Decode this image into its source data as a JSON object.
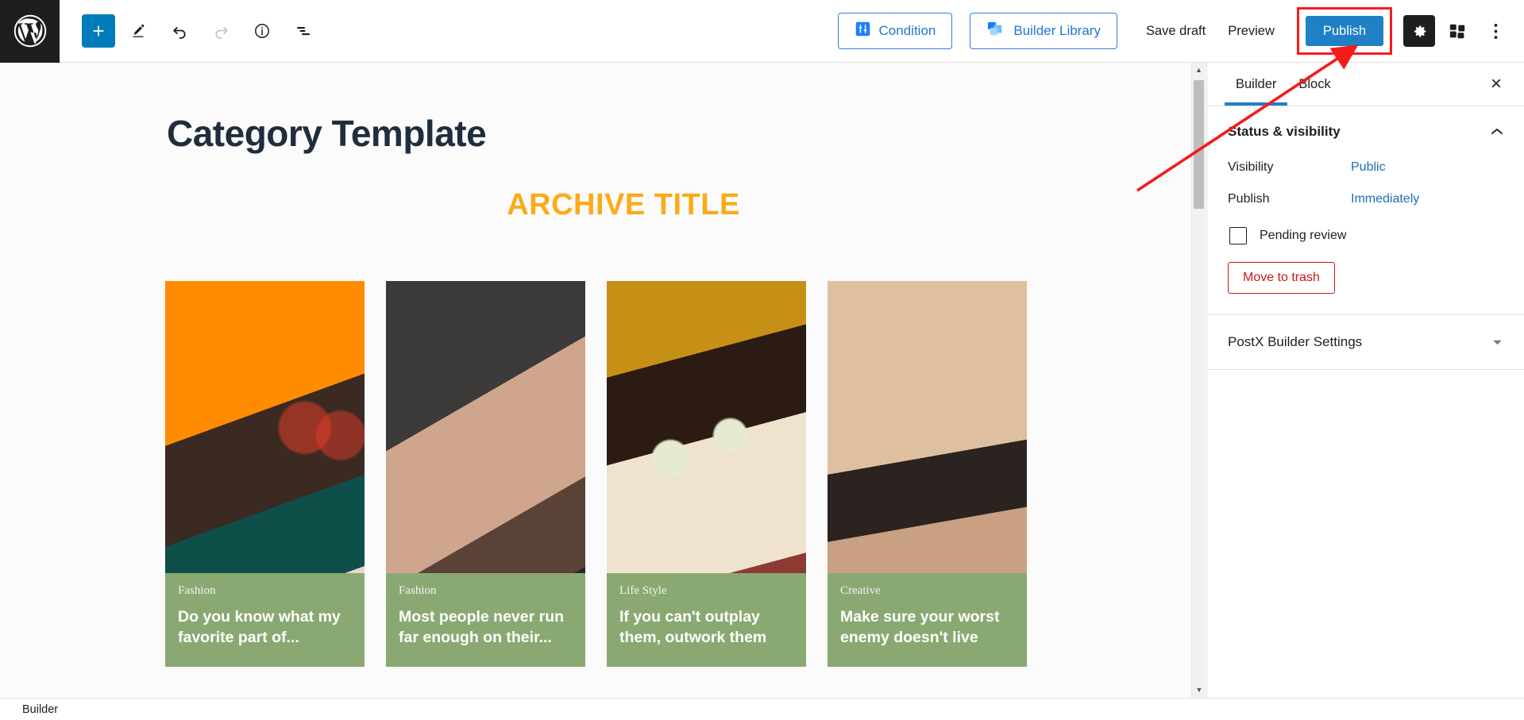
{
  "toolbar": {
    "logo_icon": "wordpress-logo-icon",
    "left_tools": [
      {
        "name": "block-inserter-button",
        "icon": "plus-icon",
        "label": "Add block"
      },
      {
        "name": "tools-button",
        "icon": "pencil-icon",
        "label": "Tools"
      },
      {
        "name": "undo-button",
        "icon": "undo-arrow-icon",
        "label": "Undo"
      },
      {
        "name": "redo-button",
        "icon": "redo-arrow-icon",
        "label": "Redo"
      },
      {
        "name": "details-button",
        "icon": "info-circle-icon",
        "label": "Details"
      },
      {
        "name": "list-view-button",
        "icon": "list-view-icon",
        "label": "List View"
      }
    ],
    "condition_label": "Condition",
    "condition_icon": "sliders-square-icon",
    "builder_library_label": "Builder Library",
    "builder_library_icon": "stacked-squares-icon",
    "save_draft_label": "Save draft",
    "preview_label": "Preview",
    "publish_label": "Publish",
    "settings_icon": "gear-icon",
    "blocks_icon": "blocks-icon",
    "options_icon": "three-dots-vertical-icon",
    "publish_accent": "#1f80c6",
    "highlight_color": "#f61b1b",
    "inserter_color": "#007cba"
  },
  "canvas": {
    "page_title": "Category Template",
    "archive_title": "ARCHIVE TITLE",
    "archive_title_color": "#fbaa19",
    "page_title_color": "#1f2d3d",
    "overlay_color": "#8aa972",
    "cards": [
      {
        "category": "Fashion",
        "title": "Do you know what my favorite part of...",
        "photo_class": "ph1",
        "photo_name": "woman-red-sunglasses-photo"
      },
      {
        "category": "Fashion",
        "title": "Most people never run far enough on their...",
        "photo_class": "ph2",
        "photo_name": "woman-portrait-photo"
      },
      {
        "category": "Life Style",
        "title": "If you can't outplay them, outwork them",
        "photo_class": "ph3",
        "photo_name": "two-women-cucumber-mask-photo"
      },
      {
        "category": "Creative",
        "title": "Make sure your worst enemy doesn't live",
        "photo_class": "ph4",
        "photo_name": "woman-makeup-desk-photo"
      }
    ]
  },
  "scrollbar": {
    "up_arrow": "▲",
    "down_arrow": "▼"
  },
  "sidebar": {
    "tabs": [
      {
        "label": "Builder",
        "active": true
      },
      {
        "label": "Block",
        "active": false
      }
    ],
    "close_icon": "close-icon",
    "section": {
      "title": "Status & visibility",
      "collapse_icon": "chevron-up-icon",
      "rows": [
        {
          "label": "Visibility",
          "value": "Public"
        },
        {
          "label": "Publish",
          "value": "Immediately"
        }
      ],
      "pending_review_label": "Pending review",
      "trash_label": "Move to trash"
    },
    "collapsed_section": {
      "title": "PostX Builder Settings",
      "expand_icon": "chevron-down-icon"
    },
    "accent": "#1f80c6",
    "link_color": "#1f6fb2",
    "danger_color": "#cc1818"
  },
  "statusbar": {
    "label": "Builder"
  }
}
